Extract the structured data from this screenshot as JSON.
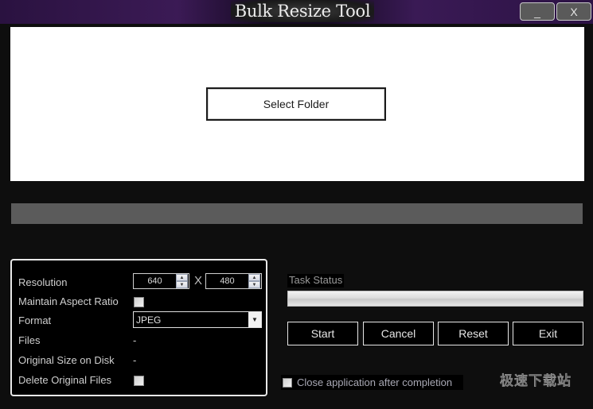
{
  "window": {
    "title": "Bulk Resize Tool",
    "minimize_label": "_",
    "close_label": "X"
  },
  "drop_area": {
    "select_folder_label": "Select Folder"
  },
  "settings": {
    "resolution": {
      "label": "Resolution",
      "width": "640",
      "height": "480",
      "separator": "X",
      "up_arrow": "▲",
      "down_arrow": "▼"
    },
    "maintain_aspect_ratio": {
      "label": "Maintain Aspect Ratio",
      "checked": false
    },
    "format": {
      "label": "Format",
      "value": "JPEG",
      "arrow": "▼"
    },
    "files": {
      "label": "Files",
      "value": "-"
    },
    "original_size": {
      "label": "Original Size on Disk",
      "value": "-"
    },
    "delete_original": {
      "label": "Delete Original Files",
      "checked": false
    }
  },
  "task": {
    "status_label": "Task Status",
    "progress_percent": 0
  },
  "actions": {
    "start": "Start",
    "cancel": "Cancel",
    "reset": "Reset",
    "exit": "Exit"
  },
  "close_after_completion": {
    "label": "Close application after completion",
    "checked": false
  },
  "watermark": "极速下载站"
}
